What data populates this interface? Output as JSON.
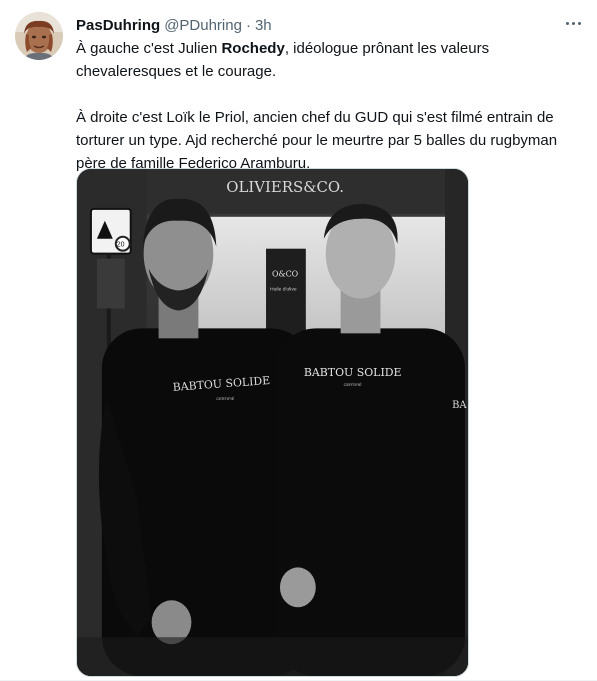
{
  "tweet": {
    "author": {
      "display_name": "PasDuhring",
      "handle": "@PDuhring",
      "avatar_icon": "profile-avatar-icon"
    },
    "separator": "·",
    "timestamp": "3h",
    "more_icon": "more-options-icon",
    "text": {
      "line1_before": "À gauche c'est Julien ",
      "line1_bold": "Rochedy",
      "line1_after": ", idéologue prônant les valeurs chevaleresques et le courage.",
      "paragraph2": "À droite c'est Loïk le Priol, ancien chef du GUD qui s'est filmé entrain de torturer un type. Ajd recherché pour le meurtre par 5 balles du rugbyman père de famille Federico Aramburu."
    },
    "media": {
      "store_sign": "OLIVIERS&CO.",
      "window_sign": "O&CO",
      "window_subtext": "Huile d'olive",
      "speed_sign": "20",
      "shirt_left": "BABTOU SOLIDE",
      "shirt_left_sub": "CERTIFIÉ",
      "shirt_right": "BABTOU SOLIDE",
      "shirt_right_sub": "CERTIFIÉ",
      "shirt_edge": "BA"
    }
  }
}
